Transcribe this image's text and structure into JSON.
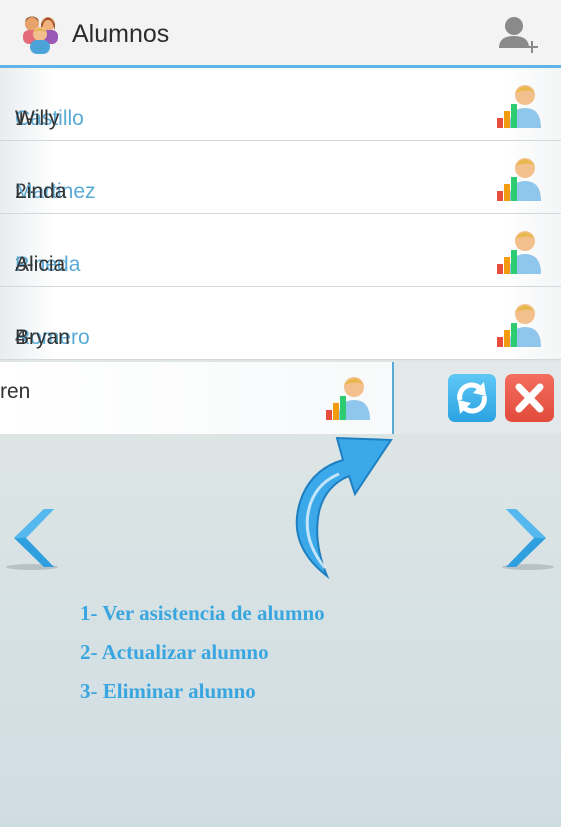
{
  "header": {
    "title": "Alumnos",
    "add_icon": "add-user-icon",
    "app_icon": "students-group-icon"
  },
  "students": [
    {
      "num": "1-",
      "last": "Castillo",
      "first": "Willy"
    },
    {
      "num": "2-",
      "last": "Martinez",
      "first": "Linda"
    },
    {
      "num": "3-",
      "last": "Pineda",
      "first": "Alicia"
    },
    {
      "num": "4-",
      "last": "Romero",
      "first": "Bryan"
    }
  ],
  "swiped_row": {
    "visible_text": "ren"
  },
  "actions": {
    "refresh_icon": "refresh-icon",
    "delete_icon": "close-icon"
  },
  "help": {
    "line1": "1- Ver asistencia de alumno",
    "line2": "2- Actualizar alumno",
    "line3": "3- Eliminar alumno"
  },
  "colors": {
    "accent": "#5aaad6",
    "help_text": "#3aa6e0",
    "delete": "#e14b3b",
    "refresh": "#2aa3e2"
  }
}
